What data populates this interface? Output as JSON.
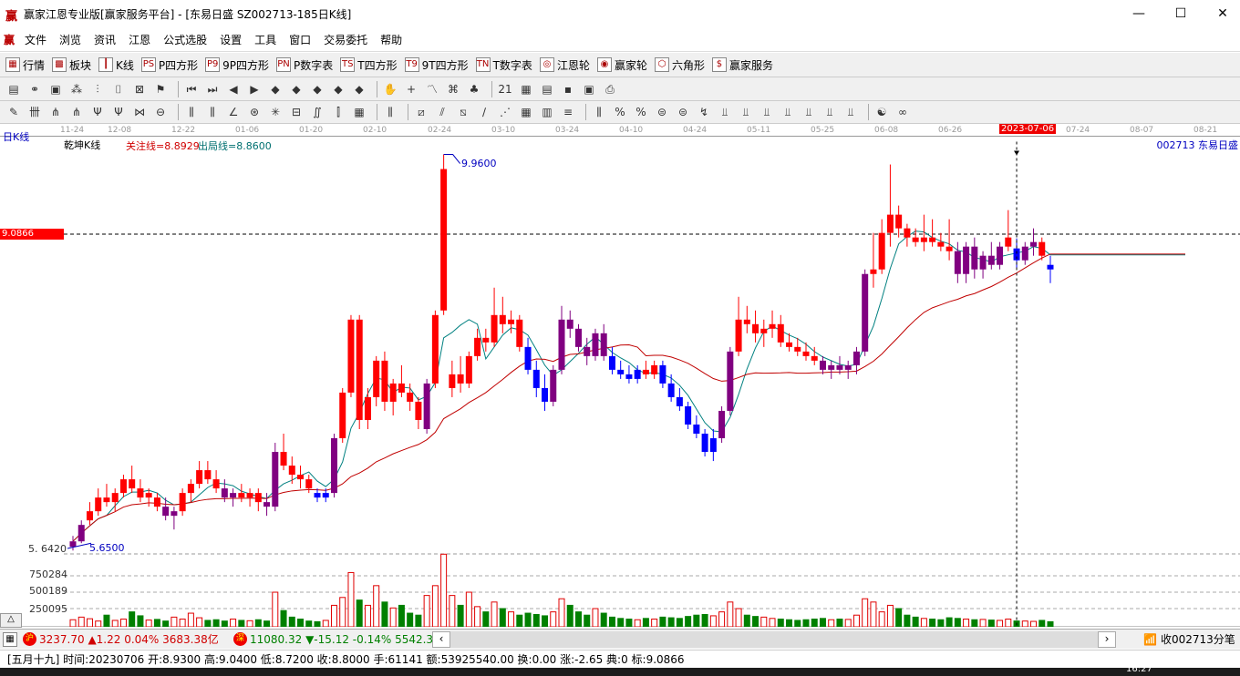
{
  "window": {
    "title": "赢家江恩专业版[赢家服务平台] - [东易日盛  SZ002713-185日K线]",
    "logo": "赢",
    "min": "—",
    "max": "☐",
    "close": "✕"
  },
  "menu": [
    "文件",
    "浏览",
    "资讯",
    "江恩",
    "公式选股",
    "设置",
    "工具",
    "窗口",
    "交易委托",
    "帮助"
  ],
  "toolbar1": [
    {
      "label": "行情",
      "icon": "table-icon",
      "glyph": "▦"
    },
    {
      "label": "板块",
      "icon": "blocks-icon",
      "glyph": "▩"
    },
    {
      "label": "K线",
      "icon": "candlestick-icon",
      "glyph": "┃"
    },
    {
      "label": "P四方形",
      "icon": "p-square-icon",
      "glyph": "PS"
    },
    {
      "label": "9P四方形",
      "icon": "9p-square-icon",
      "glyph": "P9"
    },
    {
      "label": "P数字表",
      "icon": "p-number-table-icon",
      "glyph": "PN"
    },
    {
      "label": "T四方形",
      "icon": "t-square-icon",
      "glyph": "TS"
    },
    {
      "label": "9T四方形",
      "icon": "9t-square-icon",
      "glyph": "T9"
    },
    {
      "label": "T数字表",
      "icon": "t-number-table-icon",
      "glyph": "TN"
    },
    {
      "label": "江恩轮",
      "icon": "gann-wheel-icon",
      "glyph": "◎"
    },
    {
      "label": "赢家轮",
      "icon": "winner-wheel-icon",
      "glyph": "◉"
    },
    {
      "label": "六角形",
      "icon": "hexagon-icon",
      "glyph": "⬡"
    },
    {
      "label": "赢家服务",
      "icon": "dollar-icon",
      "glyph": "$"
    }
  ],
  "toolbar2": [
    {
      "icon": "layout-icon",
      "glyph": "▤"
    },
    {
      "icon": "link-icon",
      "glyph": "⚭"
    },
    {
      "icon": "document-icon",
      "glyph": "▣"
    },
    {
      "icon": "indicator-icon",
      "glyph": "⁂"
    },
    {
      "icon": "bars-icon",
      "glyph": "⫶"
    },
    {
      "icon": "cursor-icon",
      "glyph": "⌷"
    },
    {
      "icon": "crossed-icon",
      "glyph": "⊠"
    },
    {
      "icon": "flag-icon",
      "glyph": "⚑"
    },
    {
      "icon": "first-icon",
      "glyph": "⏮"
    },
    {
      "icon": "last-icon",
      "glyph": "⏭"
    },
    {
      "icon": "prev-icon",
      "glyph": "◀"
    },
    {
      "icon": "next-icon",
      "glyph": "▶"
    },
    {
      "icon": "diamond1-icon",
      "glyph": "◆"
    },
    {
      "icon": "diamond2-icon",
      "glyph": "◆"
    },
    {
      "icon": "diamond3-icon",
      "glyph": "◆"
    },
    {
      "icon": "diamond4-icon",
      "glyph": "◆"
    },
    {
      "icon": "diamond5-icon",
      "glyph": "◆"
    },
    {
      "icon": "hand-icon",
      "glyph": "✋"
    },
    {
      "icon": "crosshair-icon",
      "glyph": "+"
    },
    {
      "icon": "trend-icon",
      "glyph": "〽"
    },
    {
      "icon": "lattice-icon",
      "glyph": "⌘"
    },
    {
      "icon": "tree-icon",
      "glyph": "♣"
    },
    {
      "icon": "calendar-icon",
      "glyph": "21"
    },
    {
      "icon": "calc-icon",
      "glyph": "▦"
    },
    {
      "icon": "notes-icon",
      "glyph": "▤"
    },
    {
      "icon": "save-icon",
      "glyph": "▪"
    },
    {
      "icon": "monitor-icon",
      "glyph": "▣"
    },
    {
      "icon": "print-icon",
      "glyph": "⎙"
    }
  ],
  "toolbar3": [
    {
      "icon": "pen-icon",
      "glyph": "✎"
    },
    {
      "icon": "grid-icon",
      "glyph": "卌"
    },
    {
      "icon": "fan-icon",
      "glyph": "⋔"
    },
    {
      "icon": "fan2-icon",
      "glyph": "⋔"
    },
    {
      "icon": "fork-icon",
      "glyph": "Ψ"
    },
    {
      "icon": "fork2-icon",
      "glyph": "Ψ"
    },
    {
      "icon": "pitch-icon",
      "glyph": "⋈"
    },
    {
      "icon": "circle-icon",
      "glyph": "⊖"
    },
    {
      "icon": "lines-icon",
      "glyph": "⫼"
    },
    {
      "icon": "lines2-icon",
      "glyph": "⫼"
    },
    {
      "icon": "angle-icon",
      "glyph": "∠"
    },
    {
      "icon": "spiral-icon",
      "glyph": "⊛"
    },
    {
      "icon": "star-icon",
      "glyph": "✳"
    },
    {
      "icon": "box-icon",
      "glyph": "⊟"
    },
    {
      "icon": "wave-icon",
      "glyph": "∬"
    },
    {
      "icon": "bars2-icon",
      "glyph": "⫿"
    },
    {
      "icon": "grid2-icon",
      "glyph": "▦"
    },
    {
      "icon": "gridline-icon",
      "glyph": "⫼"
    },
    {
      "icon": "channel-icon",
      "glyph": "⧄"
    },
    {
      "icon": "fan3-icon",
      "glyph": "⫽"
    },
    {
      "icon": "box2-icon",
      "glyph": "⧅"
    },
    {
      "icon": "line-icon",
      "glyph": "∕"
    },
    {
      "icon": "fibo-icon",
      "glyph": "⋰"
    },
    {
      "icon": "table2-icon",
      "glyph": "▦"
    },
    {
      "icon": "table3-icon",
      "glyph": "▥"
    },
    {
      "icon": "lines3-icon",
      "glyph": "≡"
    },
    {
      "icon": "ruler-icon",
      "glyph": "⫼"
    },
    {
      "icon": "percent-icon",
      "glyph": "%"
    },
    {
      "icon": "percent2-icon",
      "glyph": "%"
    },
    {
      "icon": "gann-icon",
      "glyph": "⊜"
    },
    {
      "icon": "gann2-icon",
      "glyph": "⊜"
    },
    {
      "icon": "arrow-icon",
      "glyph": "↯"
    },
    {
      "icon": "tool1-icon",
      "glyph": "⫫"
    },
    {
      "icon": "tool2-icon",
      "glyph": "⫫"
    },
    {
      "icon": "tool3-icon",
      "glyph": "⫫"
    },
    {
      "icon": "tool4-icon",
      "glyph": "⫫"
    },
    {
      "icon": "tool5-icon",
      "glyph": "⫫"
    },
    {
      "icon": "tool6-icon",
      "glyph": "⫫"
    },
    {
      "icon": "tool7-icon",
      "glyph": "⫫"
    },
    {
      "icon": "yinyang-icon",
      "glyph": "☯"
    },
    {
      "icon": "infinity-icon",
      "glyph": "∞"
    }
  ],
  "header": {
    "period": "日K线",
    "indicator": "乾坤K线",
    "focus_line": "关注线=8.8929",
    "exit_line": "出局线=8.8600",
    "stock": "002713  东易日盛",
    "mark_price": "9.0866",
    "high_label": "9.9600",
    "low_label": "5.6500",
    "low_axis": "5. 6420"
  },
  "chart_data": {
    "type": "candlestick",
    "dates": [
      "11-24",
      "12-08",
      "12-22",
      "01-06",
      "01-20",
      "02-10",
      "02-24",
      "03-10",
      "03-24",
      "04-10",
      "04-24",
      "05-11",
      "05-25",
      "06-08",
      "06-26",
      "2023-07-06",
      "07-24",
      "08-07",
      "08-21"
    ],
    "selected_date": "2023-07-06",
    "selected_index": 112,
    "mark_price": 9.0866,
    "price_range": [
      5.642,
      9.96
    ],
    "volume_ticks": [
      "750284",
      "500189",
      "250095"
    ],
    "volume_tick_values": [
      750284,
      500189,
      250095
    ],
    "candles_ohlct": [
      [
        5.66,
        5.78,
        5.62,
        5.72,
        "p"
      ],
      [
        5.72,
        5.95,
        5.7,
        5.9,
        "p"
      ],
      [
        5.95,
        6.15,
        5.9,
        6.05,
        "r"
      ],
      [
        6.05,
        6.3,
        6.0,
        6.2,
        "r"
      ],
      [
        6.2,
        6.35,
        6.1,
        6.15,
        "r"
      ],
      [
        6.15,
        6.3,
        6.05,
        6.25,
        "r"
      ],
      [
        6.25,
        6.45,
        6.2,
        6.4,
        "r"
      ],
      [
        6.4,
        6.55,
        6.25,
        6.3,
        "r"
      ],
      [
        6.3,
        6.4,
        6.15,
        6.2,
        "r"
      ],
      [
        6.2,
        6.3,
        6.1,
        6.25,
        "r"
      ],
      [
        6.2,
        6.25,
        6.05,
        6.1,
        "r"
      ],
      [
        6.1,
        6.2,
        5.95,
        6.0,
        "p"
      ],
      [
        6.0,
        6.1,
        5.85,
        6.05,
        "p"
      ],
      [
        6.05,
        6.3,
        6.0,
        6.25,
        "r"
      ],
      [
        6.25,
        6.4,
        6.15,
        6.35,
        "r"
      ],
      [
        6.35,
        6.6,
        6.3,
        6.5,
        "r"
      ],
      [
        6.5,
        6.6,
        6.35,
        6.4,
        "r"
      ],
      [
        6.4,
        6.5,
        6.25,
        6.3,
        "r"
      ],
      [
        6.3,
        6.4,
        6.15,
        6.2,
        "p"
      ],
      [
        6.2,
        6.3,
        6.1,
        6.25,
        "p"
      ],
      [
        6.25,
        6.35,
        6.15,
        6.2,
        "r"
      ],
      [
        6.2,
        6.3,
        6.1,
        6.25,
        "r"
      ],
      [
        6.25,
        6.3,
        6.05,
        6.15,
        "r"
      ],
      [
        6.15,
        6.25,
        6.0,
        6.1,
        "p"
      ],
      [
        6.1,
        6.8,
        6.05,
        6.7,
        "p"
      ],
      [
        6.7,
        6.9,
        6.5,
        6.55,
        "r"
      ],
      [
        6.55,
        6.65,
        6.35,
        6.45,
        "r"
      ],
      [
        6.45,
        6.55,
        6.3,
        6.4,
        "r"
      ],
      [
        6.4,
        6.45,
        6.25,
        6.3,
        "r"
      ],
      [
        6.25,
        6.3,
        6.15,
        6.2,
        "b"
      ],
      [
        6.2,
        6.3,
        6.15,
        6.25,
        "b"
      ],
      [
        6.25,
        6.9,
        6.2,
        6.85,
        "p"
      ],
      [
        6.85,
        7.4,
        6.8,
        7.35,
        "r"
      ],
      [
        7.35,
        8.2,
        7.3,
        8.15,
        "r"
      ],
      [
        8.15,
        8.2,
        6.95,
        7.05,
        "r"
      ],
      [
        7.05,
        7.4,
        6.95,
        7.3,
        "r"
      ],
      [
        7.3,
        7.75,
        7.2,
        7.7,
        "r"
      ],
      [
        7.7,
        7.8,
        7.15,
        7.25,
        "r"
      ],
      [
        7.25,
        7.5,
        7.1,
        7.45,
        "r"
      ],
      [
        7.45,
        7.65,
        7.3,
        7.35,
        "r"
      ],
      [
        7.35,
        7.45,
        7.15,
        7.25,
        "r"
      ],
      [
        7.25,
        7.3,
        6.95,
        7.05,
        "r"
      ],
      [
        6.95,
        7.5,
        6.9,
        7.45,
        "p"
      ],
      [
        7.45,
        8.25,
        7.4,
        8.2,
        "r"
      ],
      [
        8.25,
        9.96,
        8.2,
        9.8,
        "r"
      ],
      [
        7.4,
        7.7,
        7.3,
        7.55,
        "r"
      ],
      [
        7.55,
        7.75,
        7.35,
        7.45,
        "r"
      ],
      [
        7.45,
        7.8,
        7.4,
        7.75,
        "r"
      ],
      [
        7.75,
        8.05,
        7.7,
        7.95,
        "r"
      ],
      [
        7.95,
        8.05,
        7.8,
        7.9,
        "r"
      ],
      [
        7.9,
        8.5,
        7.85,
        8.2,
        "r"
      ],
      [
        8.2,
        8.4,
        8.0,
        8.1,
        "r"
      ],
      [
        8.1,
        8.25,
        8.0,
        8.15,
        "r"
      ],
      [
        8.15,
        8.2,
        7.8,
        7.85,
        "r"
      ],
      [
        7.85,
        7.95,
        7.55,
        7.6,
        "b"
      ],
      [
        7.6,
        7.7,
        7.3,
        7.4,
        "b"
      ],
      [
        7.4,
        7.55,
        7.15,
        7.25,
        "b"
      ],
      [
        7.25,
        7.65,
        7.2,
        7.6,
        "p"
      ],
      [
        7.6,
        8.3,
        7.55,
        8.15,
        "p"
      ],
      [
        8.15,
        8.25,
        7.95,
        8.05,
        "p"
      ],
      [
        8.05,
        8.1,
        7.8,
        7.85,
        "p"
      ],
      [
        7.85,
        7.95,
        7.65,
        7.75,
        "p"
      ],
      [
        7.75,
        8.05,
        7.7,
        8.0,
        "p"
      ],
      [
        8.0,
        8.1,
        7.7,
        7.75,
        "p"
      ],
      [
        7.75,
        7.85,
        7.55,
        7.6,
        "b"
      ],
      [
        7.6,
        7.7,
        7.5,
        7.55,
        "b"
      ],
      [
        7.55,
        7.65,
        7.45,
        7.5,
        "b"
      ],
      [
        7.5,
        7.65,
        7.45,
        7.6,
        "b"
      ],
      [
        7.6,
        7.7,
        7.5,
        7.55,
        "r"
      ],
      [
        7.55,
        7.7,
        7.5,
        7.65,
        "r"
      ],
      [
        7.65,
        7.7,
        7.4,
        7.45,
        "b"
      ],
      [
        7.45,
        7.55,
        7.25,
        7.3,
        "b"
      ],
      [
        7.3,
        7.4,
        7.15,
        7.2,
        "b"
      ],
      [
        7.2,
        7.25,
        6.95,
        7.0,
        "b"
      ],
      [
        7.0,
        7.1,
        6.85,
        6.9,
        "b"
      ],
      [
        6.9,
        6.95,
        6.65,
        6.7,
        "b"
      ],
      [
        6.7,
        6.95,
        6.6,
        6.85,
        "b"
      ],
      [
        6.85,
        7.2,
        6.8,
        7.15,
        "p"
      ],
      [
        7.15,
        7.85,
        7.1,
        7.8,
        "p"
      ],
      [
        7.8,
        8.4,
        7.75,
        8.15,
        "r"
      ],
      [
        8.15,
        8.3,
        8.0,
        8.1,
        "r"
      ],
      [
        8.1,
        8.25,
        7.9,
        8.0,
        "r"
      ],
      [
        8.0,
        8.15,
        7.85,
        8.05,
        "r"
      ],
      [
        8.05,
        8.25,
        7.95,
        8.1,
        "r"
      ],
      [
        8.1,
        8.2,
        7.85,
        7.9,
        "r"
      ],
      [
        7.9,
        8.0,
        7.8,
        7.85,
        "r"
      ],
      [
        7.85,
        7.95,
        7.75,
        7.8,
        "r"
      ],
      [
        7.8,
        7.9,
        7.7,
        7.75,
        "r"
      ],
      [
        7.75,
        7.85,
        7.65,
        7.7,
        "r"
      ],
      [
        7.7,
        7.75,
        7.55,
        7.6,
        "p"
      ],
      [
        7.6,
        7.7,
        7.5,
        7.65,
        "p"
      ],
      [
        7.65,
        7.75,
        7.55,
        7.6,
        "p"
      ],
      [
        7.6,
        7.7,
        7.5,
        7.65,
        "p"
      ],
      [
        7.65,
        7.85,
        7.55,
        7.8,
        "p"
      ],
      [
        7.8,
        8.7,
        7.75,
        8.65,
        "p"
      ],
      [
        8.65,
        9.1,
        8.5,
        8.7,
        "r"
      ],
      [
        8.7,
        9.25,
        8.65,
        9.1,
        "r"
      ],
      [
        9.1,
        9.85,
        8.95,
        9.3,
        "r"
      ],
      [
        9.3,
        9.4,
        9.05,
        9.15,
        "r"
      ],
      [
        9.15,
        9.2,
        8.95,
        9.05,
        "r"
      ],
      [
        9.05,
        9.15,
        8.95,
        9.0,
        "r"
      ],
      [
        9.0,
        9.3,
        8.9,
        9.05,
        "r"
      ],
      [
        9.05,
        9.25,
        8.95,
        9.0,
        "r"
      ],
      [
        9.0,
        9.1,
        8.9,
        8.95,
        "r"
      ],
      [
        8.95,
        9.25,
        8.8,
        8.9,
        "r"
      ],
      [
        8.9,
        9.0,
        8.55,
        8.65,
        "p"
      ],
      [
        8.65,
        9.0,
        8.55,
        8.95,
        "p"
      ],
      [
        8.95,
        9.05,
        8.6,
        8.7,
        "p"
      ],
      [
        8.7,
        8.9,
        8.6,
        8.85,
        "p"
      ],
      [
        8.85,
        9.0,
        8.7,
        8.75,
        "p"
      ],
      [
        8.75,
        9.0,
        8.7,
        8.95,
        "p"
      ],
      [
        8.95,
        9.35,
        8.9,
        9.05,
        "r"
      ],
      [
        8.93,
        9.04,
        8.72,
        8.8,
        "b"
      ],
      [
        8.8,
        9.0,
        8.75,
        8.95,
        "p"
      ],
      [
        8.95,
        9.15,
        8.85,
        9.0,
        "p"
      ],
      [
        9.0,
        9.05,
        8.8,
        8.85,
        "r"
      ],
      [
        8.75,
        8.85,
        8.55,
        8.7,
        "b"
      ]
    ],
    "volumes": [
      80,
      120,
      95,
      60,
      150,
      70,
      90,
      200,
      140,
      75,
      85,
      60,
      120,
      90,
      180,
      110,
      70,
      80,
      60,
      90,
      70,
      65,
      80,
      60,
      500,
      220,
      120,
      90,
      60,
      50,
      70,
      300,
      420,
      800,
      380,
      300,
      600,
      350,
      260,
      300,
      180,
      150,
      450,
      600,
      1080,
      450,
      300,
      500,
      280,
      200,
      350,
      250,
      200,
      150,
      180,
      160,
      140,
      200,
      400,
      300,
      200,
      150,
      250,
      180,
      120,
      100,
      90,
      80,
      100,
      90,
      120,
      110,
      100,
      130,
      150,
      160,
      140,
      200,
      350,
      250,
      150,
      130,
      120,
      100,
      90,
      80,
      70,
      80,
      90,
      100,
      80,
      90,
      85,
      150,
      400,
      350,
      200,
      300,
      250,
      150,
      120,
      100,
      90,
      80,
      110,
      100,
      90,
      80,
      85,
      75,
      70,
      90,
      61,
      60,
      55,
      70,
      50
    ],
    "ma_colors": {
      "fast": "#008080",
      "slow": "#c00000"
    },
    "candle_colors": {
      "r": "#ff0000",
      "b": "#0000ff",
      "p": "#800080"
    }
  },
  "status": {
    "sh_badge": "沪",
    "sh_text": "3237.70 ▲1.22 0.04% 3683.38亿",
    "sz_badge": "深",
    "sz_text": "11080.32 ▼-15.12 -0.14% 5542.38",
    "tick_btn": "收002713分笔",
    "scroll_left": "‹",
    "scroll_right": "›",
    "toggle": "△"
  },
  "info": "[五月十九] 时间:20230706 开:8.9300 高:9.0400 低:8.7200 收:8.8000 手:61141 额:53925540.00 换:0.00 涨:-2.65 典:0 标:9.0866",
  "taskbar": {
    "time": "16:27"
  }
}
